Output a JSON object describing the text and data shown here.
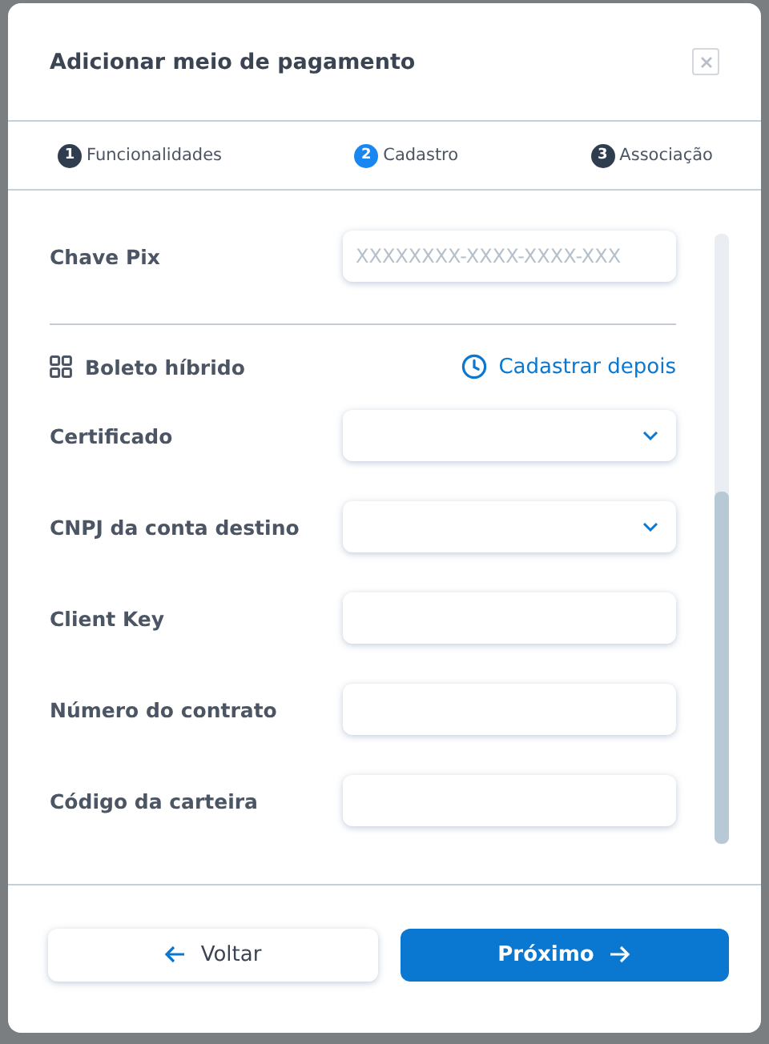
{
  "dialog": {
    "title": "Adicionar meio de pagamento"
  },
  "steps": [
    {
      "number": "1",
      "label": "Funcionalidades",
      "selected": false
    },
    {
      "number": "2",
      "label": "Cadastro",
      "selected": true
    },
    {
      "number": "3",
      "label": "Associação",
      "selected": false
    }
  ],
  "pix_field": {
    "label": "Chave Pix",
    "placeholder": "XXXXXXXX-XXXX-XXXX-XXX"
  },
  "section": {
    "title": "Boleto híbrido",
    "action": "Cadastrar depois"
  },
  "fields": [
    {
      "label": "Certificado",
      "kind": "select"
    },
    {
      "label": "CNPJ da conta destino",
      "kind": "select"
    },
    {
      "label": "Client Key",
      "kind": "text"
    },
    {
      "label": "Número do contrato",
      "kind": "text"
    },
    {
      "label": "Código da carteira",
      "kind": "text"
    }
  ],
  "buttons": {
    "back": "Voltar",
    "next": "Próximo"
  }
}
